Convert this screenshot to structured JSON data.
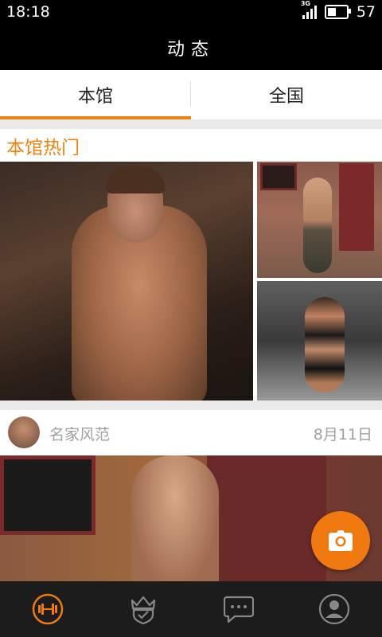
{
  "status_bar": {
    "time": "18:18",
    "network": "3G",
    "battery": "57",
    "battery_level": 0.57
  },
  "app_bar": {
    "title": "动态"
  },
  "tabs": [
    {
      "label": "本馆",
      "active": true
    },
    {
      "label": "全国",
      "active": false
    }
  ],
  "hot_section": {
    "title": "本馆热门"
  },
  "post": {
    "author": "名家风范",
    "date": "8月11日"
  },
  "fab": {
    "icon": "camera-icon"
  },
  "bottom_nav": [
    {
      "icon": "dumbbell-icon",
      "active": true
    },
    {
      "icon": "crown-shield-icon",
      "active": false
    },
    {
      "icon": "chat-icon",
      "active": false
    },
    {
      "icon": "profile-icon",
      "active": false
    }
  ],
  "colors": {
    "accent": "#f0820f",
    "bar_bg": "#000000",
    "nav_bg": "#1c1c1c",
    "muted_text": "#a0a0a0"
  }
}
